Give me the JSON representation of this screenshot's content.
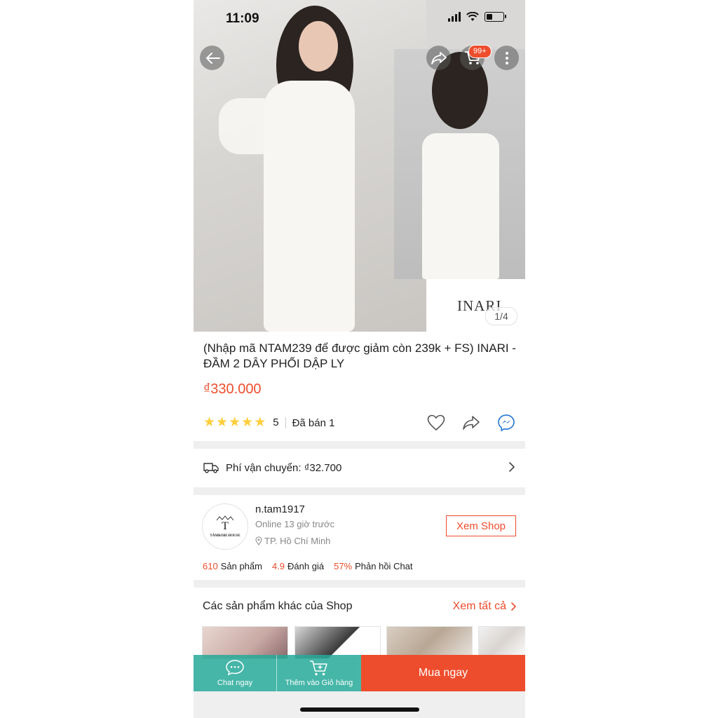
{
  "status_bar": {
    "time": "11:09"
  },
  "header": {
    "cart_badge": "99+"
  },
  "gallery": {
    "counter": "1/4",
    "brand_logo": "INARI"
  },
  "product": {
    "title": "(Nhập mã NTAM239 để được giảm còn 239k + FS) INARI - ĐẦM 2 DÂY PHỐI DẬP LY",
    "price": "₫330.000",
    "rating": "5",
    "rating_stars": 5,
    "sold": "Đã bán 1"
  },
  "shipping": {
    "label": "Phí vận chuyển: ₫32.700"
  },
  "shop": {
    "avatar_monogram": "T",
    "avatar_name": "TÂMROBI HOUSE",
    "name": "n.tam1917",
    "online": "Online 13 giờ trước",
    "location": "TP. Hồ Chí Minh",
    "view_button": "Xem Shop",
    "stats": [
      {
        "value": "610",
        "label": "Sản phẩm"
      },
      {
        "value": "4.9",
        "label": "Đánh giá"
      },
      {
        "value": "57%",
        "label": "Phản hồi Chat"
      }
    ]
  },
  "related": {
    "title": "Các sản phẩm khác của Shop",
    "see_all": "Xem tất cả"
  },
  "bottom_bar": {
    "chat": "Chat ngay",
    "add_cart": "Thêm vào Giỏ hàng",
    "buy": "Mua ngay"
  },
  "colors": {
    "accent": "#ee4d2d",
    "teal": "#26aa99",
    "star": "#ffce3d"
  },
  "icons": [
    "back-icon",
    "share-icon",
    "cart-icon",
    "more-icon",
    "heart-icon",
    "messenger-icon",
    "truck-icon",
    "chevron-right-icon",
    "location-pin-icon",
    "chat-icon",
    "add-to-cart-icon"
  ]
}
